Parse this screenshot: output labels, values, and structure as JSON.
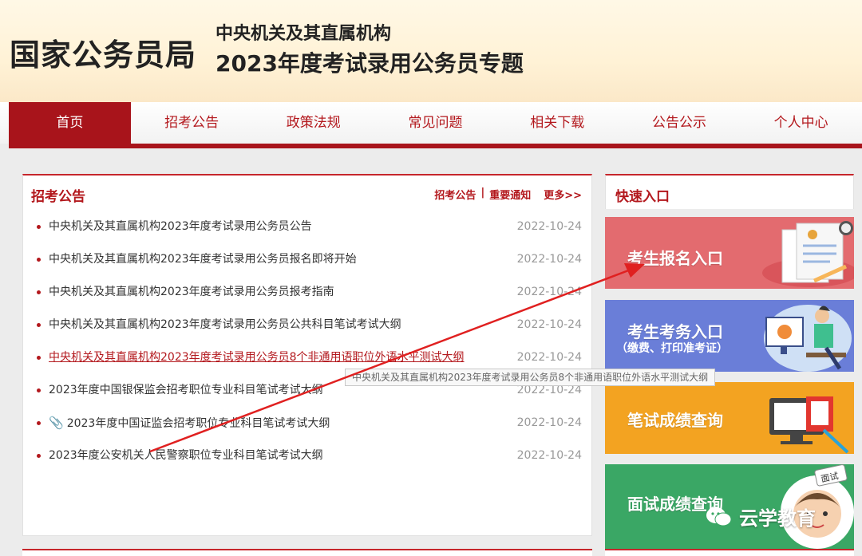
{
  "header": {
    "logo": "国家公务员局",
    "subtitle_line1": "中央机关及其直属机构",
    "subtitle_line2": "2023年度考试录用公务员专题"
  },
  "nav": {
    "items": [
      "首页",
      "招考公告",
      "政策法规",
      "常见问题",
      "相关下载",
      "公告公示",
      "个人中心"
    ],
    "active_index": 0
  },
  "announcements": {
    "title": "招考公告",
    "link_announce": "招考公告",
    "separator": "|",
    "link_notice": "重要通知",
    "link_more": "更多>>",
    "items": [
      {
        "title": "中央机关及其直属机构2023年度考试录用公务员公告",
        "date": "2022-10-24"
      },
      {
        "title": "中央机关及其直属机构2023年度考试录用公务员报名即将开始",
        "date": "2022-10-24"
      },
      {
        "title": "中央机关及其直属机构2023年度考试录用公务员报考指南",
        "date": "2022-10-24"
      },
      {
        "title": "中央机关及其直属机构2023年度考试录用公务员公共科目笔试考试大纲",
        "date": "2022-10-24"
      },
      {
        "title": "中央机关及其直属机构2023年度考试录用公务员8个非通用语职位外语水平测试大纲",
        "date": "2022-10-24"
      },
      {
        "title": "2023年度中国银保监会招考职位专业科目笔试考试大纲",
        "date": "2022-10-24"
      },
      {
        "title": "2023年度中国证监会招考职位专业科目笔试考试大纲",
        "date": "2022-10-24"
      },
      {
        "title": "2023年度公安机关人民警察职位专业科目笔试考试大纲",
        "date": "2022-10-24"
      }
    ],
    "tooltip": "中央机关及其直属机构2023年度考试录用公务员8个非通用语职位外语水平测试大纲"
  },
  "quick": {
    "title": "快速入口",
    "register": "考生报名入口",
    "exam_service": "考生考务入口",
    "exam_service_sub": "（缴费、打印准考证）",
    "written_score": "笔试成绩查询",
    "interview_score": "面试成绩查询",
    "interview_badge": "面试"
  },
  "watermark": "云学教育",
  "colors": {
    "brand_red": "#a8141b",
    "card_register": "#e36b6f",
    "card_service": "#6a7ed8",
    "card_written": "#f3a321",
    "card_interview": "#3aa765"
  }
}
